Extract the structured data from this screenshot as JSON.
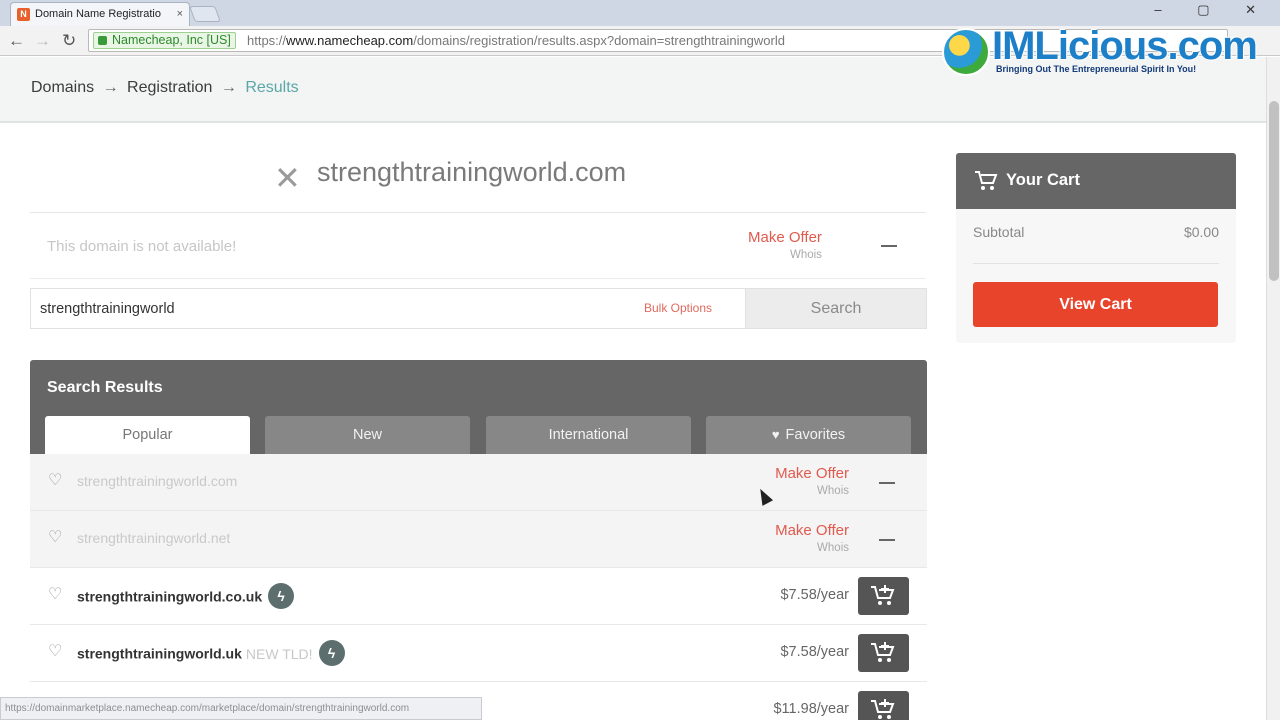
{
  "browser": {
    "tab_title": "Domain Name Registratio",
    "tab_close": "×",
    "favicon": "N",
    "window_controls": "– ▢ ✕",
    "nav": {
      "back": "←",
      "forward": "→",
      "reload": "↻"
    },
    "ev_label": "Namecheap, Inc [US]",
    "url_scheme": "https://",
    "url_host": "www.namecheap.com",
    "url_path": "/domains/registration/results.aspx?domain=strengthtrainingworld",
    "status_url": "https://domainmarketplace.namecheap.com/marketplace/domain/strengthtrainingworld.com"
  },
  "watermark": {
    "title": "IMLicious.com",
    "subtitle": "Bringing Out The Entrepreneurial Spirit In You!"
  },
  "breadcrumb": {
    "items": [
      "Domains",
      "Registration",
      "Results"
    ],
    "separator": "→"
  },
  "domain_head": {
    "close_glyph": "✕",
    "domain": "strengthtrainingworld.com",
    "unavailable_msg": "This domain is not available!",
    "make_offer": "Make Offer",
    "whois": "Whois"
  },
  "search": {
    "value": "strengthtrainingworld",
    "bulk_options": "Bulk Options",
    "button": "Search"
  },
  "results": {
    "title": "Search Results",
    "tabs": [
      {
        "label": "Popular"
      },
      {
        "label": "New"
      },
      {
        "label": "International"
      },
      {
        "label": "Favorites"
      }
    ],
    "rows": [
      {
        "domain": "strengthtrainingworld.com",
        "make_offer": "Make Offer",
        "whois": "Whois"
      },
      {
        "domain": "strengthtrainingworld.net",
        "make_offer": "Make Offer",
        "whois": "Whois"
      },
      {
        "domain": "strengthtrainingworld.co.uk",
        "price": "$7.58/year"
      },
      {
        "domain": "strengthtrainingworld.uk",
        "new_tld": "NEW TLD!",
        "price": "$7.58/year"
      },
      {
        "price": "$11.98/year"
      }
    ]
  },
  "cart": {
    "title": "Your Cart",
    "subtotal_label": "Subtotal",
    "subtotal_value": "$0.00",
    "view_cart": "View Cart"
  },
  "colors": {
    "accent_red": "#e8442c",
    "offer_red": "#e05a4d",
    "breadcrumb_active": "#5ba7a7",
    "header_gray": "#666666"
  }
}
